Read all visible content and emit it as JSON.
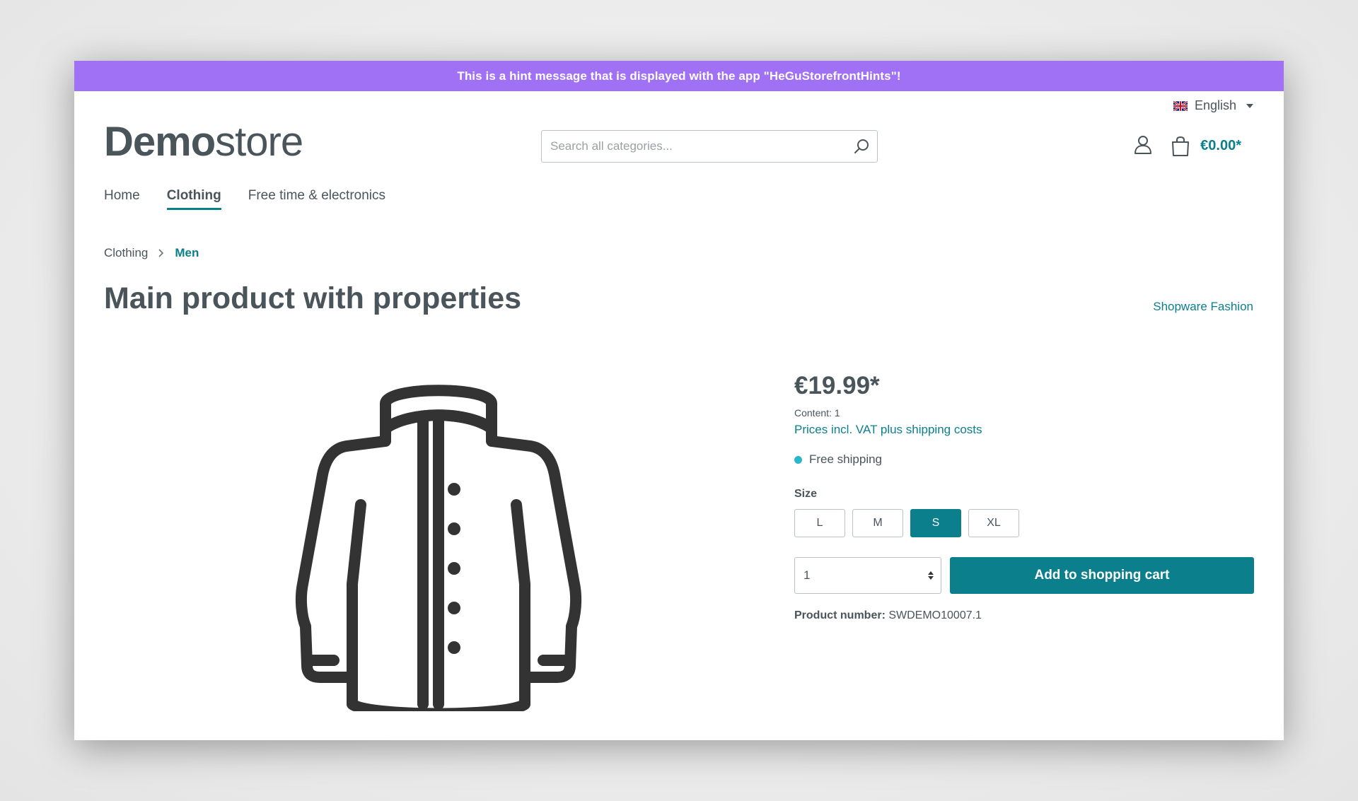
{
  "hint": {
    "message": "This is a hint message that is displayed with the app \"HeGuStorefrontHints\"!"
  },
  "language": {
    "label": "English",
    "icon": "uk-flag-icon"
  },
  "logo": {
    "bold": "Demo",
    "light": "store"
  },
  "search": {
    "placeholder": "Search all categories...",
    "value": ""
  },
  "cart": {
    "total": "€0.00*"
  },
  "nav": {
    "items": [
      {
        "label": "Home"
      },
      {
        "label": "Clothing"
      },
      {
        "label": "Free time & electronics"
      }
    ],
    "active": "Clothing"
  },
  "breadcrumb": {
    "items": [
      "Clothing",
      "Men"
    ]
  },
  "product": {
    "title": "Main product with properties",
    "manufacturer": "Shopware Fashion",
    "price": "€19.99*",
    "content": "Content: 1",
    "tax_note": "Prices incl. VAT plus shipping costs",
    "delivery": "Free shipping",
    "size_label": "Size",
    "sizes": [
      "L",
      "M",
      "S",
      "XL"
    ],
    "selected_size": "S",
    "quantity": "1",
    "add_to_cart_label": "Add to shopping cart",
    "number_label": "Product number:",
    "number_value": "SWDEMO10007.1"
  },
  "colors": {
    "accent": "#0b7f8c",
    "hint_bar": "#a070f5",
    "delivery_dot": "#2ab7ca"
  }
}
